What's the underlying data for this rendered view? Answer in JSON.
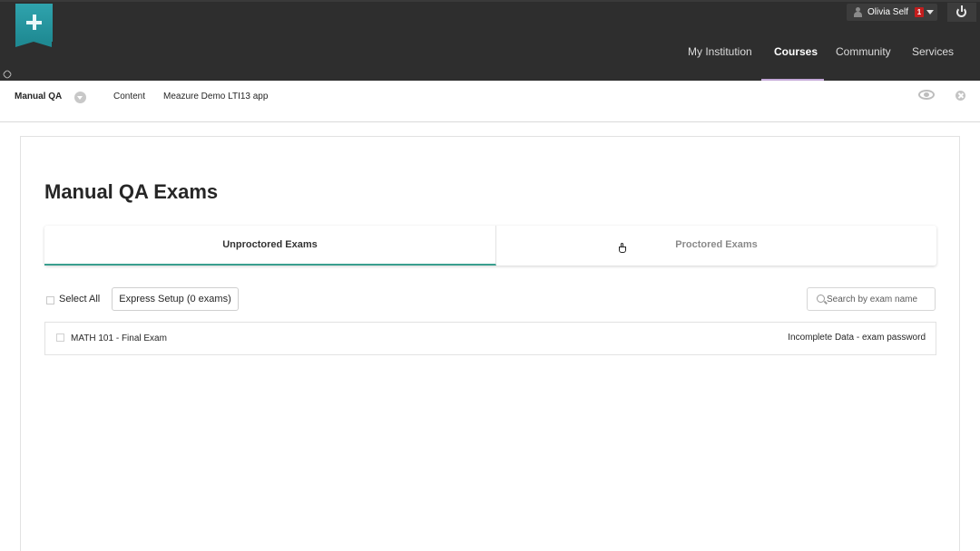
{
  "header": {
    "user": {
      "name": "Olivia Self",
      "notifications": "1"
    },
    "nav": [
      {
        "label": "My Institution",
        "active": false
      },
      {
        "label": "Courses",
        "active": true
      },
      {
        "label": "Community",
        "active": false
      },
      {
        "label": "Services",
        "active": false
      }
    ]
  },
  "breadcrumb": {
    "course": "Manual QA",
    "items": [
      "Content",
      "Meazure Demo LTI13 app"
    ]
  },
  "main": {
    "title": "Manual QA Exams",
    "tabs": [
      {
        "label": "Unproctored Exams",
        "active": true
      },
      {
        "label": "Proctored Exams",
        "active": false
      }
    ],
    "toolbar": {
      "select_all_label": "Select All",
      "express_setup_label": "Express Setup (0 exams)",
      "search_placeholder": "Search by exam name"
    },
    "exams": [
      {
        "name": "MATH 101 - Final Exam",
        "status": "Incomplete Data - exam password"
      }
    ]
  },
  "colors": {
    "header_bg": "#2e2e2e",
    "accent_tab": "#3a9f8f",
    "nav_underline": "#c4a8d8",
    "logo": "#2fa3ad",
    "badge": "#c21e1e"
  },
  "icons": [
    "plus-icon",
    "link-icon",
    "user-icon",
    "caret-down-icon",
    "power-icon",
    "chevron-down-icon",
    "eye-icon",
    "close-icon",
    "search-icon",
    "hand-cursor-icon"
  ]
}
